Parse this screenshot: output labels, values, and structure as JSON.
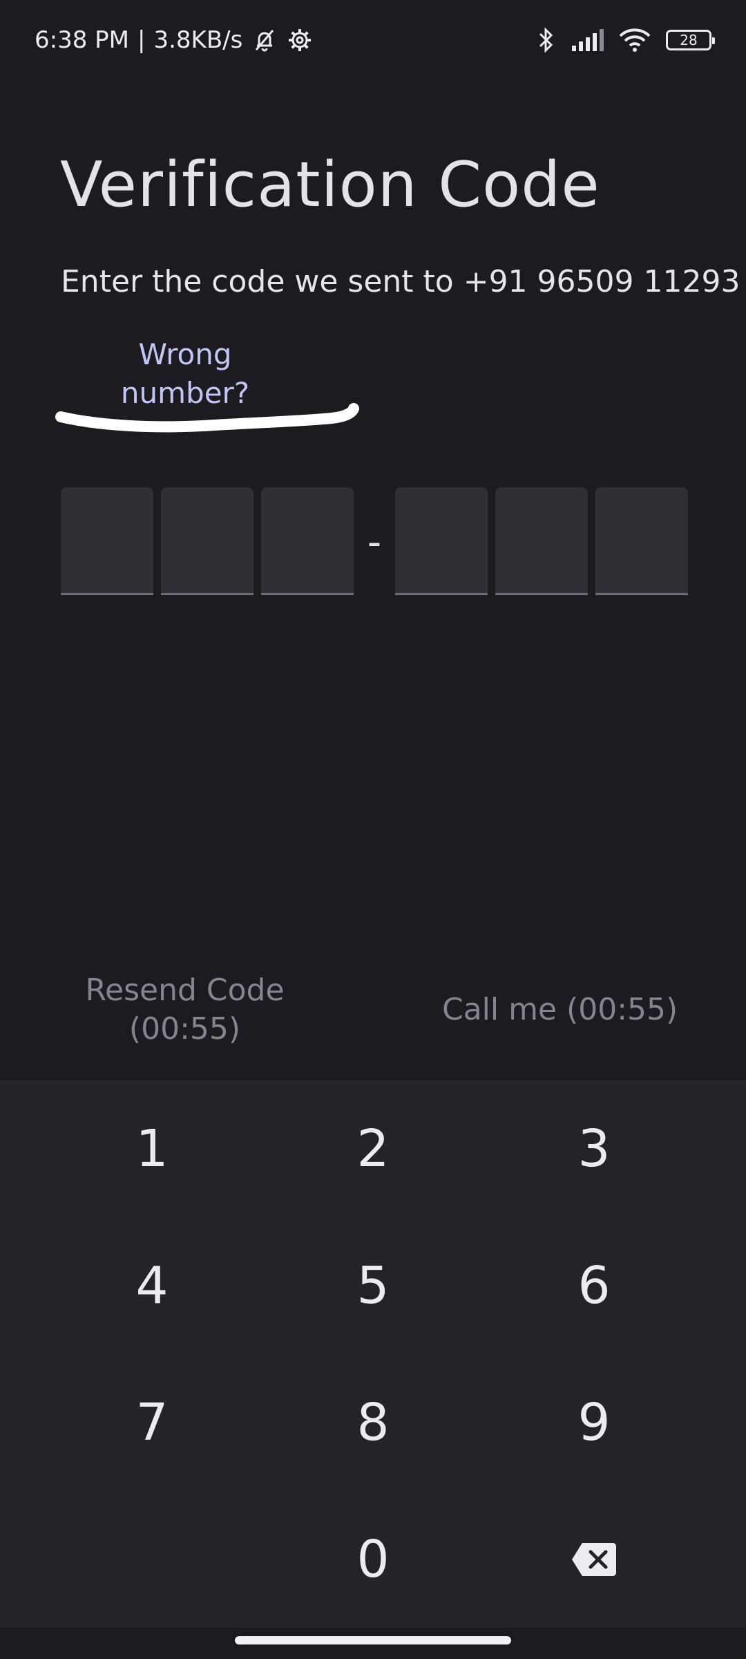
{
  "status_bar": {
    "time": "6:38 PM",
    "separator": "|",
    "net_speed": "3.8KB/s",
    "icons": [
      "silent-mode-icon",
      "settings-gear-icon",
      "bluetooth-icon",
      "signal-icon",
      "wifi-icon"
    ],
    "battery": "28"
  },
  "header": {
    "title": "Verification Code",
    "subtitle": "Enter the code we sent to +91 96509 11293",
    "wrong_number_line1": "Wrong",
    "wrong_number_line2": "number?"
  },
  "code_input": {
    "digits": [
      "",
      "",
      "",
      "",
      "",
      ""
    ],
    "separator": "-"
  },
  "actions": {
    "resend_line1": "Resend Code",
    "resend_line2": "(00:55)",
    "call_me": "Call me (00:55)"
  },
  "keypad": {
    "keys": [
      "1",
      "2",
      "3",
      "4",
      "5",
      "6",
      "7",
      "8",
      "9",
      "",
      "0",
      "backspace"
    ]
  },
  "colors": {
    "background": "#1c1c20",
    "keypad_bg": "#242428",
    "link": "#c2c6f7",
    "disabled_text": "#85858b"
  }
}
